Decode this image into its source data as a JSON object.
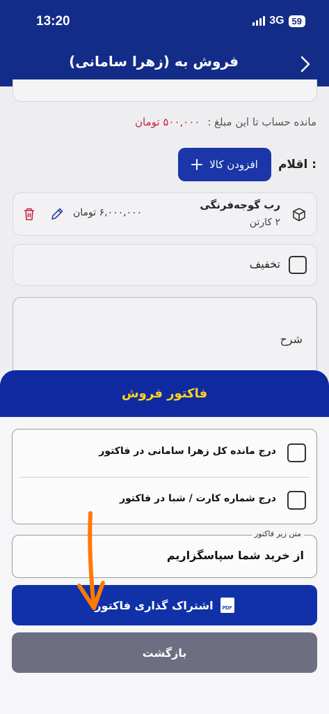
{
  "status_bar": {
    "time": "13:20",
    "network": "3G",
    "battery": "59"
  },
  "header": {
    "title": "فروش به (زهرا سامانی)",
    "back_icon": "chevron-right-icon"
  },
  "form": {
    "remaining_label": "مانده حساب تا این مبلغ :",
    "remaining_amount": "۵۰۰,۰۰۰ تومان",
    "items_label": "اقلام :",
    "add_item_label": "افزودن کالا",
    "product": {
      "name": "رب گوجه‌فرنگی",
      "quantity": "۲ کارتن",
      "price": "۶,۰۰۰,۰۰۰ تومان"
    },
    "discount_label": "تخفیف",
    "description_label": "شرح"
  },
  "sheet": {
    "title": "فاکتور فروش",
    "options": [
      {
        "label": "درج مانده کل زهرا سامانی در فاکتور",
        "checked": false
      },
      {
        "label": "درج شماره کارت / شبا در فاکتور",
        "checked": false
      }
    ],
    "footer_text_label": "متن زیر فاکتور",
    "footer_text_value": "از خرید شما سپاسگزاریم",
    "share_button": "اشتراک گذاری فاکتور",
    "pdf_icon_text": "PDF",
    "back_button": "بازگشت"
  },
  "colors": {
    "header_bg": "#132c87",
    "primary": "#1131a8",
    "accent_title": "#ffd321",
    "amount_red": "#c4243f",
    "secondary_btn": "#6e6e82",
    "annotation_arrow": "#ff7a00"
  }
}
